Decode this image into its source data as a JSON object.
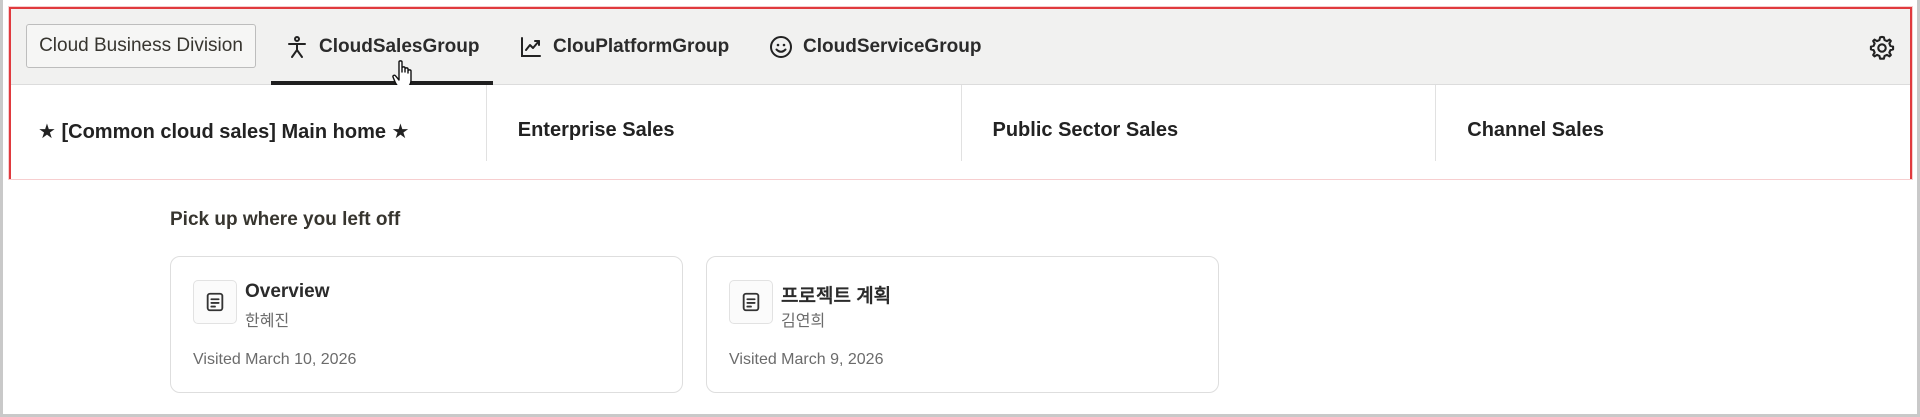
{
  "header": {
    "division_label": "Cloud Business Division",
    "tabs": [
      {
        "label": "CloudSalesGroup",
        "icon": "person-icon",
        "active": true
      },
      {
        "label": "ClouPlatformGroup",
        "icon": "chart-line-icon",
        "active": false
      },
      {
        "label": "CloudServiceGroup",
        "icon": "smiley-icon",
        "active": false
      }
    ],
    "settings_icon": "gear-icon"
  },
  "subnav": {
    "items": [
      {
        "label": "★ [Common cloud sales] Main home ★"
      },
      {
        "label": "Enterprise Sales"
      },
      {
        "label": "Public Sector Sales"
      },
      {
        "label": "Channel Sales"
      }
    ]
  },
  "recent": {
    "title": "Pick up where you left off",
    "cards": [
      {
        "title": "Overview",
        "author": "한혜진",
        "visited": "Visited March 10, 2026",
        "icon": "document-icon"
      },
      {
        "title": "프로젝트 계획",
        "author": "김연희",
        "visited": "Visited March 9, 2026",
        "icon": "document-icon"
      }
    ]
  },
  "colors": {
    "highlight_border": "#e03a3e",
    "tabbar_bg": "#f1f1f0",
    "active_tab_underline": "#1f1f1f"
  }
}
